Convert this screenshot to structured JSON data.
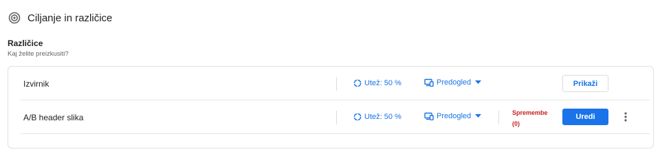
{
  "header": {
    "icon": "target-icon",
    "title": "Ciljanje in različice"
  },
  "section": {
    "title": "Različice",
    "subtitle": "Kaj želite preizkusiti?"
  },
  "variants": [
    {
      "name": "Izvirnik",
      "weight_label": "Utež: 50 %",
      "preview_label": "Predogled",
      "action_label": "Prikaži"
    },
    {
      "name": "A/B header slika",
      "weight_label": "Utež: 50 %",
      "preview_label": "Predogled",
      "changes_label": "Spremembe",
      "changes_count": "(0)",
      "action_label": "Uredi"
    }
  ],
  "colors": {
    "accent": "#1a73e8",
    "changes": "#c5221f"
  }
}
